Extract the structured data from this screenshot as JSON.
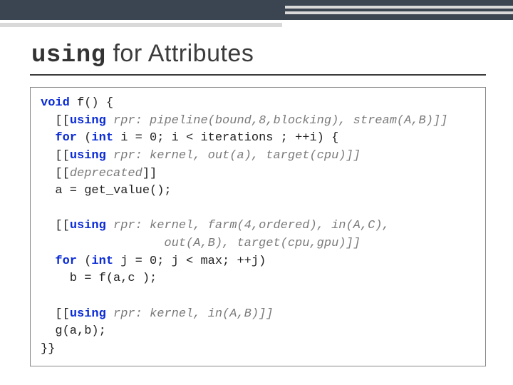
{
  "title": {
    "keyword": "using",
    "rest": " for Attributes"
  },
  "code": {
    "l01a": "void",
    "l01b": " f() {",
    "l02a": "  [[",
    "l02b": "using",
    "l02c": " rpr: pipeline(bound,8,blocking), stream(A,B)]]",
    "l03a": "  ",
    "l03b": "for",
    "l03c": " (",
    "l03d": "int",
    "l03e": " i = 0; i < iterations ; ++i) {",
    "l04a": "  [[",
    "l04b": "using",
    "l04c": " rpr: kernel, out(a), target(cpu)]]",
    "l05a": "  [[",
    "l05b": "deprecated",
    "l05c": "]]",
    "l06": "  a = get_value();",
    "blank1": "",
    "l07a": "  [[",
    "l07b": "using",
    "l07c": " rpr: kernel, farm(4,ordered), in(A,C),",
    "l08": "                 out(A,B), target(cpu,gpu)]]",
    "l09a": "  ",
    "l09b": "for",
    "l09c": " (",
    "l09d": "int",
    "l09e": " j = 0; j < max; ++j)",
    "l10": "    b = f(a,c );",
    "blank2": "",
    "l11a": "  [[",
    "l11b": "using",
    "l11c": " rpr: kernel, in(A,B)]]",
    "l12": "  g(a,b);",
    "l13": "}}"
  }
}
